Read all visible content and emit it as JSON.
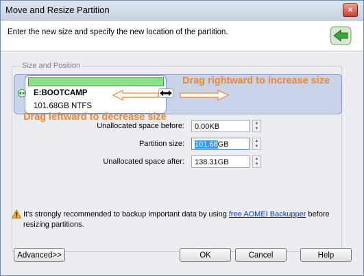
{
  "window": {
    "title": "Move and Resize Partition",
    "close_glyph": "×"
  },
  "header": {
    "text": "Enter the new size and specify the new location of the partition.",
    "icon": "back-arrow-icon"
  },
  "group": {
    "label": "Size and Position"
  },
  "partition": {
    "name": "E:BOOTCAMP",
    "size": "101.68GB NTFS",
    "bar_color": "#8ee08a",
    "track_color": "#c9d3ea"
  },
  "annotations": {
    "right": "Drag rightward to increase size",
    "left": "Drag leftward to decrease size",
    "color": "#f0862e"
  },
  "fields": [
    {
      "label": "Unallocated space before:",
      "value": "0.00KB",
      "selected": "",
      "unit": ""
    },
    {
      "label": "Partition size:",
      "value": "",
      "selected": "101.68",
      "unit": "GB"
    },
    {
      "label": "Unallocated space after:",
      "value": "138.31GB",
      "selected": "",
      "unit": ""
    }
  ],
  "warning": {
    "pre": "It's strongly recommended to backup important data by using ",
    "link": "free AOMEI Backupper",
    "post": " before resizing partitions."
  },
  "buttons": {
    "advanced": "Advanced>>",
    "ok": "OK",
    "cancel": "Cancel",
    "help": "Help"
  }
}
